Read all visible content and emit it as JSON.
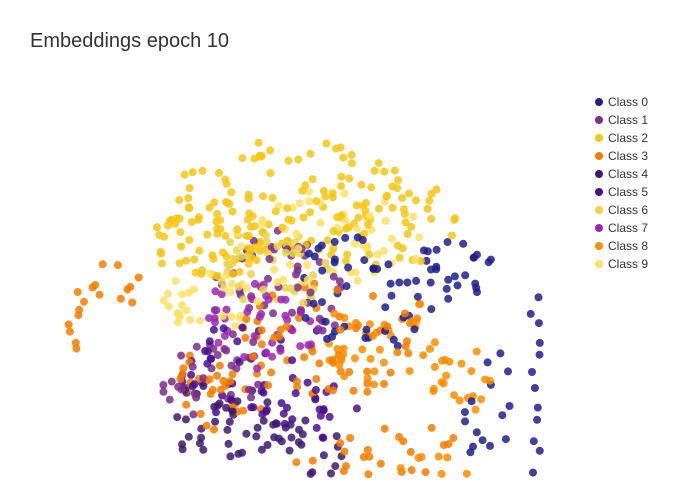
{
  "title": "Embeddings epoch 10",
  "legend": {
    "items": [
      {
        "label": "Class 0",
        "color": "#1f1f8c"
      },
      {
        "label": "Class 1",
        "color": "#7b2d8b"
      },
      {
        "label": "Class 2",
        "color": "#f5c518"
      },
      {
        "label": "Class 3",
        "color": "#f57c00"
      },
      {
        "label": "Class 4",
        "color": "#3d1a6e"
      },
      {
        "label": "Class 5",
        "color": "#4a0e8f"
      },
      {
        "label": "Class 6",
        "color": "#e8d44d"
      },
      {
        "label": "Class 7",
        "color": "#9c27b0"
      },
      {
        "label": "Class 8",
        "color": "#ff8c00"
      },
      {
        "label": "Class 9",
        "color": "#ffe066"
      }
    ]
  },
  "classes": {
    "0": {
      "color": "#1f1f8c"
    },
    "1": {
      "color": "#7b2d8b"
    },
    "2": {
      "color": "#f5c518"
    },
    "3": {
      "color": "#f57c00"
    },
    "4": {
      "color": "#3d1a6e"
    },
    "5": {
      "color": "#4a0e8f"
    },
    "6": {
      "color": "#e8d44d"
    },
    "7": {
      "color": "#9c27b0"
    },
    "8": {
      "color": "#ff8c00"
    },
    "9": {
      "color": "#ffe066"
    }
  }
}
